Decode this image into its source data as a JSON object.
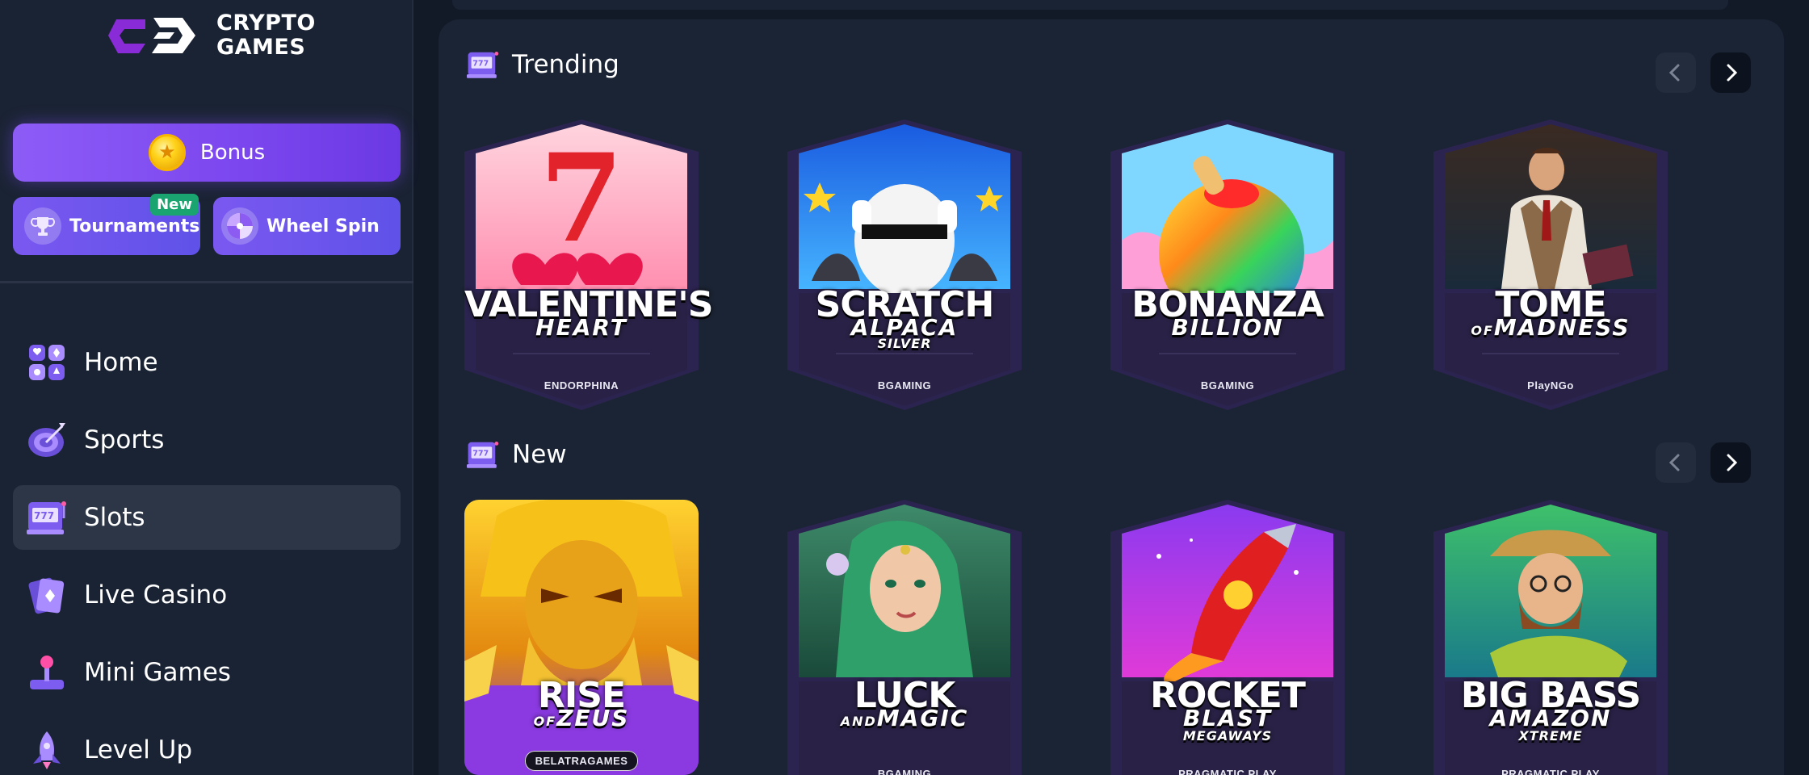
{
  "logo": {
    "line1": "CRYPTO",
    "line2": "GAMES"
  },
  "sidebar": {
    "bonus_label": "Bonus",
    "tournaments_label": "Tournaments",
    "tournaments_badge": "New",
    "wheel_label": "Wheel Spin",
    "nav": [
      {
        "label": "Home",
        "icon": "cards-suits-icon"
      },
      {
        "label": "Sports",
        "icon": "target-icon"
      },
      {
        "label": "Slots",
        "icon": "slot-machine-icon",
        "active": true
      },
      {
        "label": "Live Casino",
        "icon": "playing-card-icon"
      },
      {
        "label": "Mini Games",
        "icon": "joystick-icon"
      },
      {
        "label": "Level Up",
        "icon": "rocket-icon"
      }
    ]
  },
  "sections": [
    {
      "title": "Trending",
      "games": [
        {
          "line1": "VALENTINE'S",
          "line2": "HEART",
          "line3": "",
          "provider": "ENDORPHINA"
        },
        {
          "line1": "SCRATCH",
          "line2": "ALPACA",
          "line3": "SILVER",
          "provider": "BGAMING"
        },
        {
          "line1": "BONANZA",
          "line2": "BILLION",
          "line3": "",
          "provider": "BGAMING"
        },
        {
          "line1": "TOME",
          "pre2": "OF",
          "line2": "MADNESS",
          "line3": "",
          "provider": "PlayNGo"
        }
      ]
    },
    {
      "title": "New",
      "games": [
        {
          "line1": "RISE",
          "pre2": "OF",
          "line2": "ZEUS",
          "line3": "",
          "provider": "BELATRAGAMES"
        },
        {
          "line1": "LUCK",
          "pre2": "AND",
          "line2": "MAGIC",
          "line3": "",
          "provider": "BGAMING"
        },
        {
          "line1": "ROCKET",
          "line2": "BLAST",
          "line3": "MEGAWAYS",
          "provider": "PRAGMATIC PLAY"
        },
        {
          "line1": "BIG BASS",
          "line2": "AMAZON",
          "line3": "XTREME",
          "provider": "PRAGMATIC PLAY"
        }
      ]
    }
  ],
  "colors": {
    "accent": "#7b46ee",
    "sidebar_bg": "#1a2333",
    "panel_bg": "#1b2434",
    "badge_green": "#1aa46f"
  }
}
